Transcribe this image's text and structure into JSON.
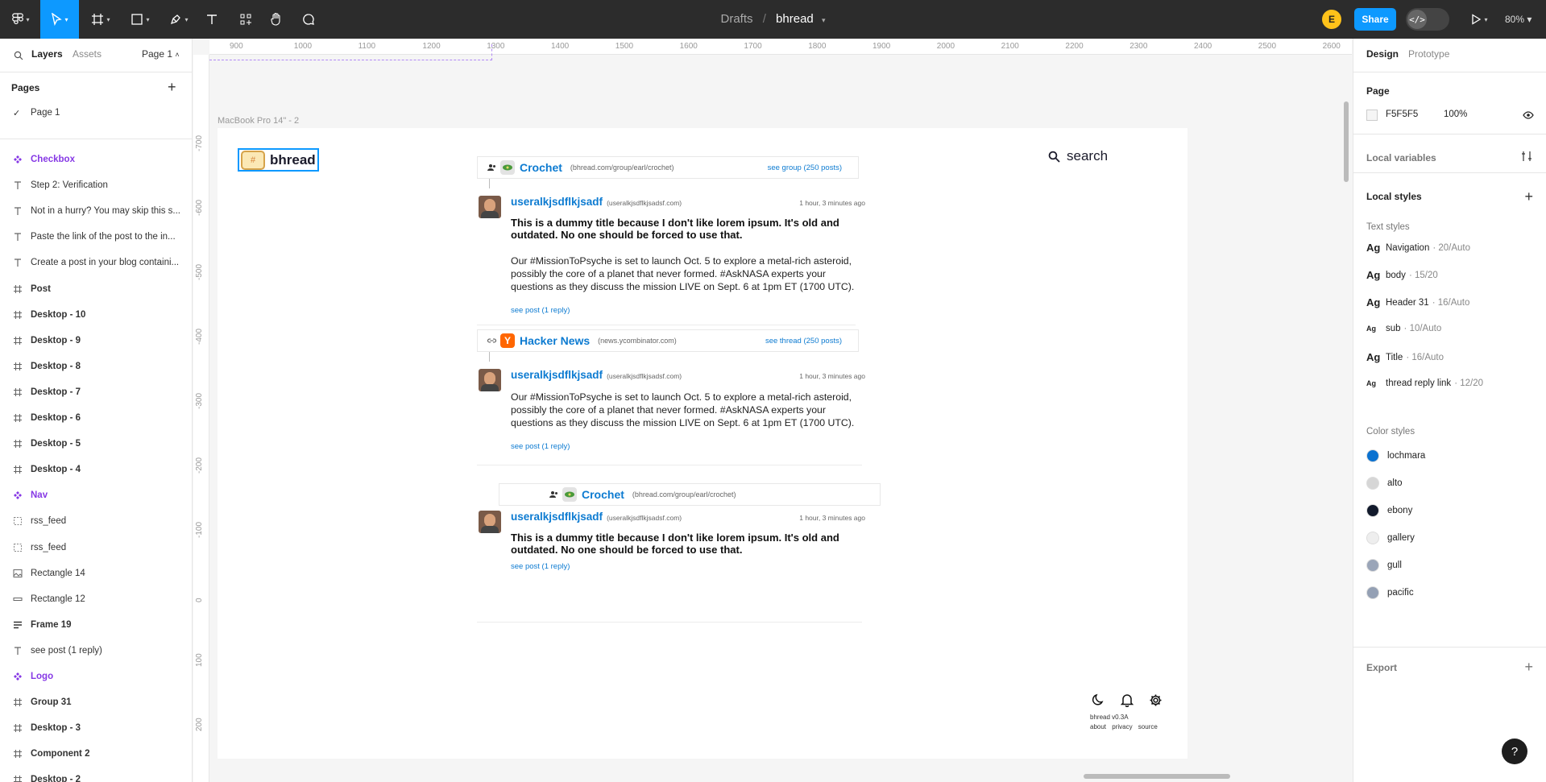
{
  "toolbar": {
    "breadcrumb_project": "Drafts",
    "breadcrumb_separator": "/",
    "file_name": "bhread",
    "user_initial": "E",
    "share_label": "Share",
    "dev_mode_glyph": "</>",
    "zoom": "80%"
  },
  "left_panel": {
    "tab_layers": "Layers",
    "tab_assets": "Assets",
    "page_selector": "Page 1",
    "pages_title": "Pages",
    "pages": [
      "Page 1"
    ],
    "layers": [
      {
        "icon": "component",
        "label": "Checkbox"
      },
      {
        "icon": "text",
        "label": "Step 2: Verification"
      },
      {
        "icon": "text",
        "label": "Not in a hurry? You may skip this s..."
      },
      {
        "icon": "text",
        "label": "Paste the link of the post to the in..."
      },
      {
        "icon": "text",
        "label": "Create a post in your blog containi..."
      },
      {
        "icon": "frame",
        "label": "Post"
      },
      {
        "icon": "frame",
        "label": "Desktop - 10"
      },
      {
        "icon": "frame",
        "label": "Desktop - 9"
      },
      {
        "icon": "frame",
        "label": "Desktop - 8"
      },
      {
        "icon": "frame",
        "label": "Desktop - 7"
      },
      {
        "icon": "frame",
        "label": "Desktop - 6"
      },
      {
        "icon": "frame",
        "label": "Desktop - 5"
      },
      {
        "icon": "frame",
        "label": "Desktop - 4"
      },
      {
        "icon": "component",
        "label": "Nav"
      },
      {
        "icon": "dashed",
        "label": "rss_feed"
      },
      {
        "icon": "dashed",
        "label": "rss_feed"
      },
      {
        "icon": "image",
        "label": "Rectangle 14"
      },
      {
        "icon": "rect",
        "label": "Rectangle 12"
      },
      {
        "icon": "autolayout",
        "label": "Frame 19"
      },
      {
        "icon": "text",
        "label": "see post (1 reply)"
      },
      {
        "icon": "component",
        "label": "Logo"
      },
      {
        "icon": "frame",
        "label": "Group 31"
      },
      {
        "icon": "frame",
        "label": "Desktop - 3"
      },
      {
        "icon": "frame",
        "label": "Component 2"
      },
      {
        "icon": "frame",
        "label": "Desktop - 2"
      }
    ]
  },
  "canvas": {
    "ruler_top": [
      "900",
      "1000",
      "1100",
      "1200",
      "1300",
      "1400",
      "1500",
      "1600",
      "1700",
      "1800",
      "1900",
      "2000",
      "2100",
      "2200",
      "2300",
      "2400",
      "2500",
      "2600"
    ],
    "ruler_left": [
      "-700",
      "-600",
      "-500",
      "-400",
      "-300",
      "-200",
      "-100",
      "0",
      "100",
      "200",
      "300"
    ],
    "frame_label": "MacBook Pro 14\" - 2",
    "design": {
      "logo_glyph": "#",
      "brand": "bhread",
      "search_label": "search",
      "group1": {
        "name": "Crochet",
        "url": "(bhread.com/group/earl/crochet)",
        "link": "see group (250 posts)"
      },
      "post1": {
        "user": "useralkjsdflkjsadf",
        "handle": "(useralkjsdflkjsadsf.com)",
        "time": "1 hour, 3 minutes ago",
        "title": "This is a dummy title because I don't like lorem ipsum. It's old and outdated. No one should be forced to use that.",
        "body": "Our #MissionToPsyche is set to launch Oct. 5 to explore a metal-rich asteroid, possibly the core of a planet that never formed. #AskNASA experts your questions as they discuss the mission LIVE on Sept. 6 at 1pm ET (1700 UTC).",
        "link": "see post (1 reply)"
      },
      "group2": {
        "icon_letter": "Y",
        "name": "Hacker News",
        "url": "(news.ycombinator.com)",
        "link": "see thread (250 posts)"
      },
      "post2": {
        "user": "useralkjsdflkjsadf",
        "handle": "(useralkjsdflkjsadsf.com)",
        "time": "1 hour, 3 minutes ago",
        "body": "Our #MissionToPsyche is set to launch Oct. 5 to explore a metal-rich asteroid, possibly the core of a planet that never formed. #AskNASA experts your questions as they discuss the mission LIVE on Sept. 6 at 1pm ET (1700 UTC).",
        "link": "see post (1 reply)"
      },
      "group3": {
        "name": "Crochet",
        "url": "(bhread.com/group/earl/crochet)"
      },
      "post3": {
        "user": "useralkjsdflkjsadf",
        "handle": "(useralkjsdflkjsadsf.com)",
        "time": "1 hour, 3 minutes ago",
        "title": "This is a dummy title because I don't like lorem ipsum. It's old and outdated. No one should be forced to use that.",
        "link": "see post (1 reply)"
      },
      "footer_version": "bhread v0.3A",
      "footer_links": "about privacy source"
    }
  },
  "right_panel": {
    "tab_design": "Design",
    "tab_prototype": "Prototype",
    "page_title": "Page",
    "page_color": "F5F5F5",
    "page_opacity": "100%",
    "local_variables": "Local variables",
    "local_styles": "Local styles",
    "text_styles_title": "Text styles",
    "text_styles": [
      {
        "name": "Navigation",
        "meta": "· 20/Auto"
      },
      {
        "name": "body",
        "meta": "· 15/20"
      },
      {
        "name": "Header 31",
        "meta": "· 16/Auto"
      },
      {
        "name": "sub",
        "meta": "· 10/Auto"
      },
      {
        "name": "Title",
        "meta": "· 16/Auto"
      },
      {
        "name": "thread reply link",
        "meta": "· 12/20"
      }
    ],
    "color_styles_title": "Color styles",
    "color_styles": [
      {
        "name": "lochmara",
        "color": "#0b72d0"
      },
      {
        "name": "alto",
        "color": "#d6d6d6"
      },
      {
        "name": "ebony",
        "color": "#121a2c"
      },
      {
        "name": "gallery",
        "color": "#eeeeee"
      },
      {
        "name": "gull",
        "color": "#9aa5b8"
      },
      {
        "name": "pacific",
        "color": "#94a0b4"
      }
    ],
    "export": "Export",
    "help": "?"
  }
}
